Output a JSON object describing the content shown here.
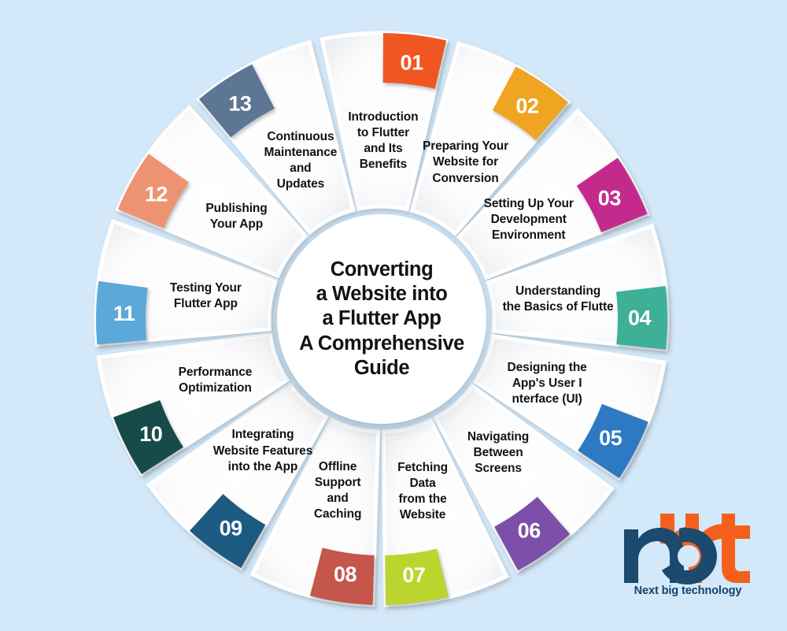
{
  "background_color": "#d3e8f8",
  "center": {
    "title": "Converting\na Website into\na Flutter App\nA Comprehensive\nGuide"
  },
  "chart_data": {
    "type": "pie",
    "title": "Converting a Website into a Flutter App A Comprehensive Guide",
    "legend": "none",
    "categories": [
      "Introduction to Flutter and Its Benefits",
      "Preparing Your Website for Conversion",
      "Setting Up Your Development Environment",
      "Understanding the Basics of Flutte",
      "Designing the App's User Interface (UI)",
      "Navigating Between Screens",
      "Fetching Data from the Website",
      "Offline Support and Caching",
      "Integrating Website Features into the App",
      "Performance Optimization",
      "Testing Your Flutter App",
      "Publishing Your App",
      "Continuous Maintenance and Updates"
    ],
    "values": [
      1,
      1,
      1,
      1,
      1,
      1,
      1,
      1,
      1,
      1,
      1,
      1,
      1
    ],
    "xlabel": "",
    "ylabel": ""
  },
  "segments": [
    {
      "number": "01",
      "label": "Introduction\nto Flutter\nand Its\nBenefits",
      "color": "#ef5622",
      "color_dark": "#d4481a"
    },
    {
      "number": "02",
      "label": "Preparing Your\nWebsite for\nConversion",
      "color": "#efa424",
      "color_dark": "#d48c18"
    },
    {
      "number": "03",
      "label": "Setting Up Your\nDevelopment\nEnvironment",
      "color": "#c4298b",
      "color_dark": "#a82277"
    },
    {
      "number": "04",
      "label": "Understanding\nthe Basics of Flutte",
      "color": "#3cb097",
      "color_dark": "#2f9580"
    },
    {
      "number": "05",
      "label": "Designing the\nApp's User I\nnterface (UI)",
      "color": "#2d79c3",
      "color_dark": "#2465a6"
    },
    {
      "number": "06",
      "label": "Navigating\nBetween\nScreens",
      "color": "#7b4fa8",
      "color_dark": "#674091"
    },
    {
      "number": "07",
      "label": "Fetching\nData\nfrom the\nWebsite",
      "color": "#bcd42f",
      "color_dark": "#a3ba22"
    },
    {
      "number": "08",
      "label": "Offline\nSupport\nand\nCaching",
      "color": "#c4564b",
      "color_dark": "#76b84a"
    },
    {
      "number": "09",
      "label": "Integrating\nWebsite Features\ninto the App",
      "color": "#1d5a82",
      "color_dark": "#164a6c"
    },
    {
      "number": "10",
      "label": "Performance\nOptimization",
      "color": "#154b4a",
      "color_dark": "#0f3c3b"
    },
    {
      "number": "11",
      "label": "Testing Your\nFlutter App",
      "color": "#5ba8d8",
      "color_dark": "#4a92c0"
    },
    {
      "number": "12",
      "label": "Publishing\nYour App",
      "color": "#ee9372",
      "color_dark": "#d67c5c"
    },
    {
      "number": "13",
      "label": "Continuous\nMaintenance\nand\nUpdates",
      "color": "#5c7693",
      "color_dark": "#4b637d"
    }
  ],
  "logo": {
    "wordmark": "nbt",
    "tagline": "Next big technology",
    "orange": "#f4601c",
    "navy": "#1b4a6e"
  }
}
